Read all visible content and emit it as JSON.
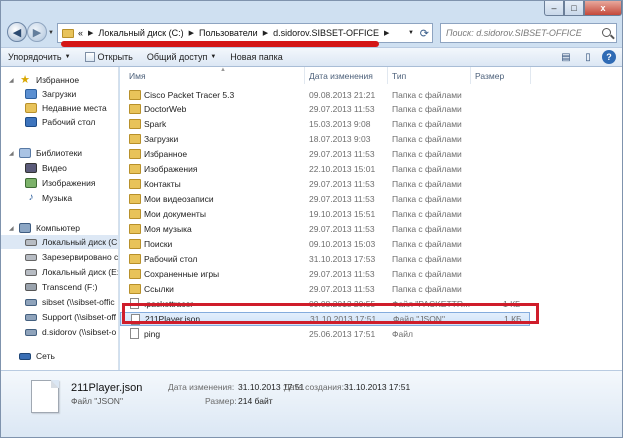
{
  "window": {
    "minimize": "–",
    "maximize": "□",
    "close": "x"
  },
  "address": {
    "overflow": "«",
    "crumbs": [
      "Локальный диск (C:)",
      "Пользователи",
      "d.sidorov.SIBSET-OFFICE"
    ]
  },
  "search": {
    "placeholder": "Поиск: d.sidorov.SIBSET-OFFICE"
  },
  "toolbar": {
    "organize": "Упорядочить",
    "open": "Открыть",
    "share": "Общий доступ",
    "new_folder": "Новая папка"
  },
  "navpane": {
    "items": [
      {
        "label": "Избранное",
        "icon": "star-icon"
      },
      {
        "label": "Загрузки",
        "icon": "folder-icon"
      },
      {
        "label": "Недавние места",
        "icon": "folder-icon"
      },
      {
        "label": "Рабочий стол",
        "icon": "desktop-icon"
      },
      {
        "label": "Библиотеки",
        "icon": "library-icon"
      },
      {
        "label": "Видео",
        "icon": "video-icon"
      },
      {
        "label": "Изображения",
        "icon": "image-icon"
      },
      {
        "label": "Музыка",
        "icon": "music-icon"
      },
      {
        "label": "Компьютер",
        "icon": "computer-icon"
      },
      {
        "label": "Локальный диск (C",
        "icon": "drive-icon"
      },
      {
        "label": "Зарезервировано с",
        "icon": "drive-icon"
      },
      {
        "label": "Локальный диск (E:",
        "icon": "drive-icon"
      },
      {
        "label": "Transcend (F:)",
        "icon": "usb-drive-icon"
      },
      {
        "label": "sibset (\\\\sibset-offic",
        "icon": "network-drive-icon"
      },
      {
        "label": "Support (\\\\sibset-off",
        "icon": "network-drive-icon"
      },
      {
        "label": "d.sidorov (\\\\sibset-o",
        "icon": "network-drive-icon"
      },
      {
        "label": "Сеть",
        "icon": "network-icon"
      }
    ]
  },
  "columns": {
    "name": "Имя",
    "date": "Дата изменения",
    "type": "Тип",
    "size": "Размер"
  },
  "files": [
    {
      "name": "Cisco Packet Tracer 5.3",
      "date": "09.08.2013 21:21",
      "type": "Папка с файлами",
      "size": ""
    },
    {
      "name": "DoctorWeb",
      "date": "29.07.2013 11:53",
      "type": "Папка с файлами",
      "size": ""
    },
    {
      "name": "Spark",
      "date": "15.03.2013 9:08",
      "type": "Папка с файлами",
      "size": ""
    },
    {
      "name": "Загрузки",
      "date": "18.07.2013 9:03",
      "type": "Папка с файлами",
      "size": ""
    },
    {
      "name": "Избранное",
      "date": "29.07.2013 11:53",
      "type": "Папка с файлами",
      "size": ""
    },
    {
      "name": "Изображения",
      "date": "22.10.2013 15:01",
      "type": "Папка с файлами",
      "size": ""
    },
    {
      "name": "Контакты",
      "date": "29.07.2013 11:53",
      "type": "Папка с файлами",
      "size": ""
    },
    {
      "name": "Мои видеозаписи",
      "date": "29.07.2013 11:53",
      "type": "Папка с файлами",
      "size": ""
    },
    {
      "name": "Мои документы",
      "date": "19.10.2013 15:51",
      "type": "Папка с файлами",
      "size": ""
    },
    {
      "name": "Моя музыка",
      "date": "29.07.2013 11:53",
      "type": "Папка с файлами",
      "size": ""
    },
    {
      "name": "Поиски",
      "date": "09.10.2013 15:03",
      "type": "Папка с файлами",
      "size": ""
    },
    {
      "name": "Рабочий стол",
      "date": "31.10.2013 17:53",
      "type": "Папка с файлами",
      "size": ""
    },
    {
      "name": "Сохраненные игры",
      "date": "29.07.2013 11:53",
      "type": "Папка с файлами",
      "size": ""
    },
    {
      "name": "Ссылки",
      "date": "29.07.2013 11:53",
      "type": "Папка с файлами",
      "size": ""
    },
    {
      "name": ".packettracer",
      "date": "09.08.2013 20:55",
      "type": "Файл \"PACKETTR...",
      "size": "1 КБ"
    },
    {
      "name": "211Player.json",
      "date": "31.10.2013 17:51",
      "type": "Файл \"JSON\"",
      "size": "1 КБ"
    },
    {
      "name": "ping",
      "date": "25.06.2013 17:51",
      "type": "Файл",
      "size": ""
    }
  ],
  "details": {
    "name": "211Player.json",
    "type": "Файл \"JSON\"",
    "modified_label": "Дата изменения:",
    "modified_value": "31.10.2013 17:51",
    "created_label": "Дата создания:",
    "created_value": "31.10.2013 17:51",
    "size_label": "Размер:",
    "size_value": "214 байт"
  },
  "colors": {
    "annotation_red": "#cf1d2a",
    "selection": "#cfe2f8",
    "folder": "#e8c35a"
  }
}
